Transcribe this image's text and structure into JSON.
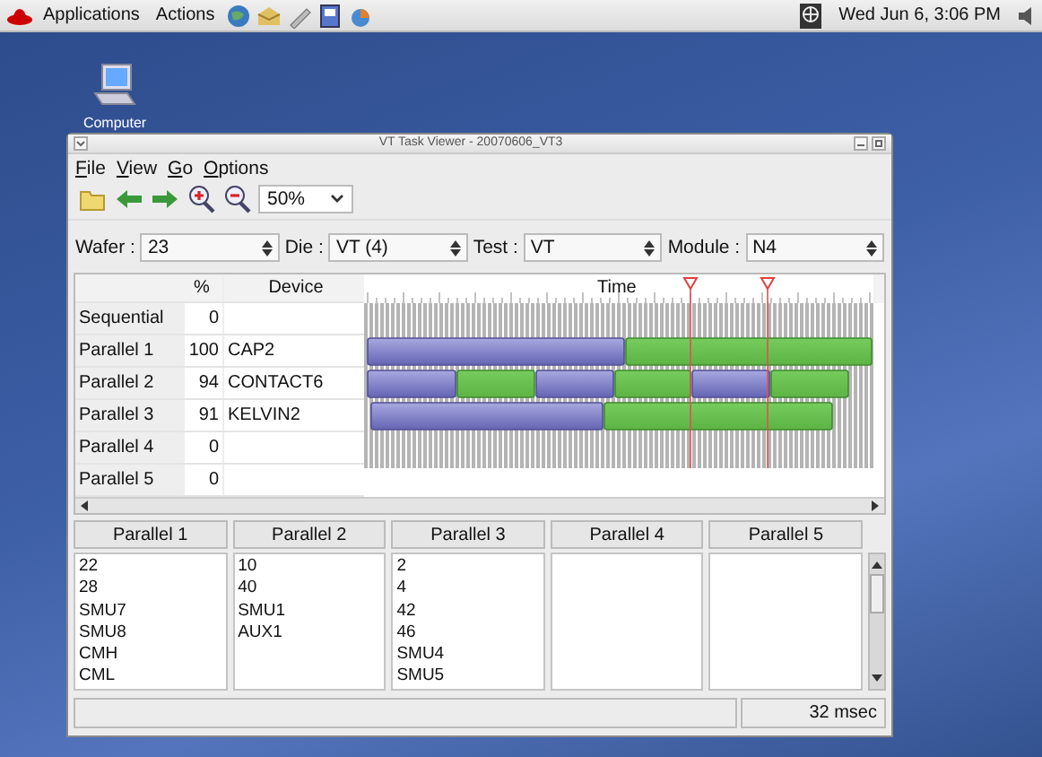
{
  "top_panel": {
    "menus": [
      "Applications",
      "Actions"
    ],
    "clock": "Wed Jun 6,  3:06 PM"
  },
  "desktop_icons": [
    {
      "label": "Computer"
    }
  ],
  "window": {
    "title": "VT Task Viewer - 20070606_VT3"
  },
  "menu": [
    "File",
    "View",
    "Go",
    "Options"
  ],
  "toolbar": {
    "zoom": "50%"
  },
  "selectors": [
    {
      "label": "Wafer :",
      "value": "23"
    },
    {
      "label": "Die :",
      "value": "VT (4)"
    },
    {
      "label": "Test :",
      "value": "VT"
    },
    {
      "label": "Module :",
      "value": "N4"
    }
  ],
  "grid": {
    "columns": [
      "%",
      "Device",
      "Time"
    ],
    "rows": [
      {
        "name": "Sequential",
        "percent": "0"
      },
      {
        "name": "Parallel 1",
        "percent": "100",
        "device": "CAP2"
      },
      {
        "name": "Parallel 2",
        "percent": "94",
        "device": "CONTACT6"
      },
      {
        "name": "Parallel 3",
        "percent": "91",
        "device": "KELVIN2"
      },
      {
        "name": "Parallel 4",
        "percent": "0"
      },
      {
        "name": "Parallel 5",
        "percent": "0"
      }
    ]
  },
  "groups": [
    {
      "title": "Parallel 1",
      "items": [
        "22",
        "28",
        "SMU7",
        "SMU8",
        "CMH",
        "CML"
      ]
    },
    {
      "title": "Parallel 2",
      "items": [
        "10",
        "40",
        "SMU1",
        "AUX1"
      ]
    },
    {
      "title": "Parallel 3",
      "items": [
        "2",
        "4",
        "42",
        "46",
        "SMU4",
        "SMU5"
      ]
    },
    {
      "title": "Parallel 4"
    },
    {
      "title": "Parallel 5"
    }
  ],
  "status_bar": {
    "time": "32 msec"
  }
}
